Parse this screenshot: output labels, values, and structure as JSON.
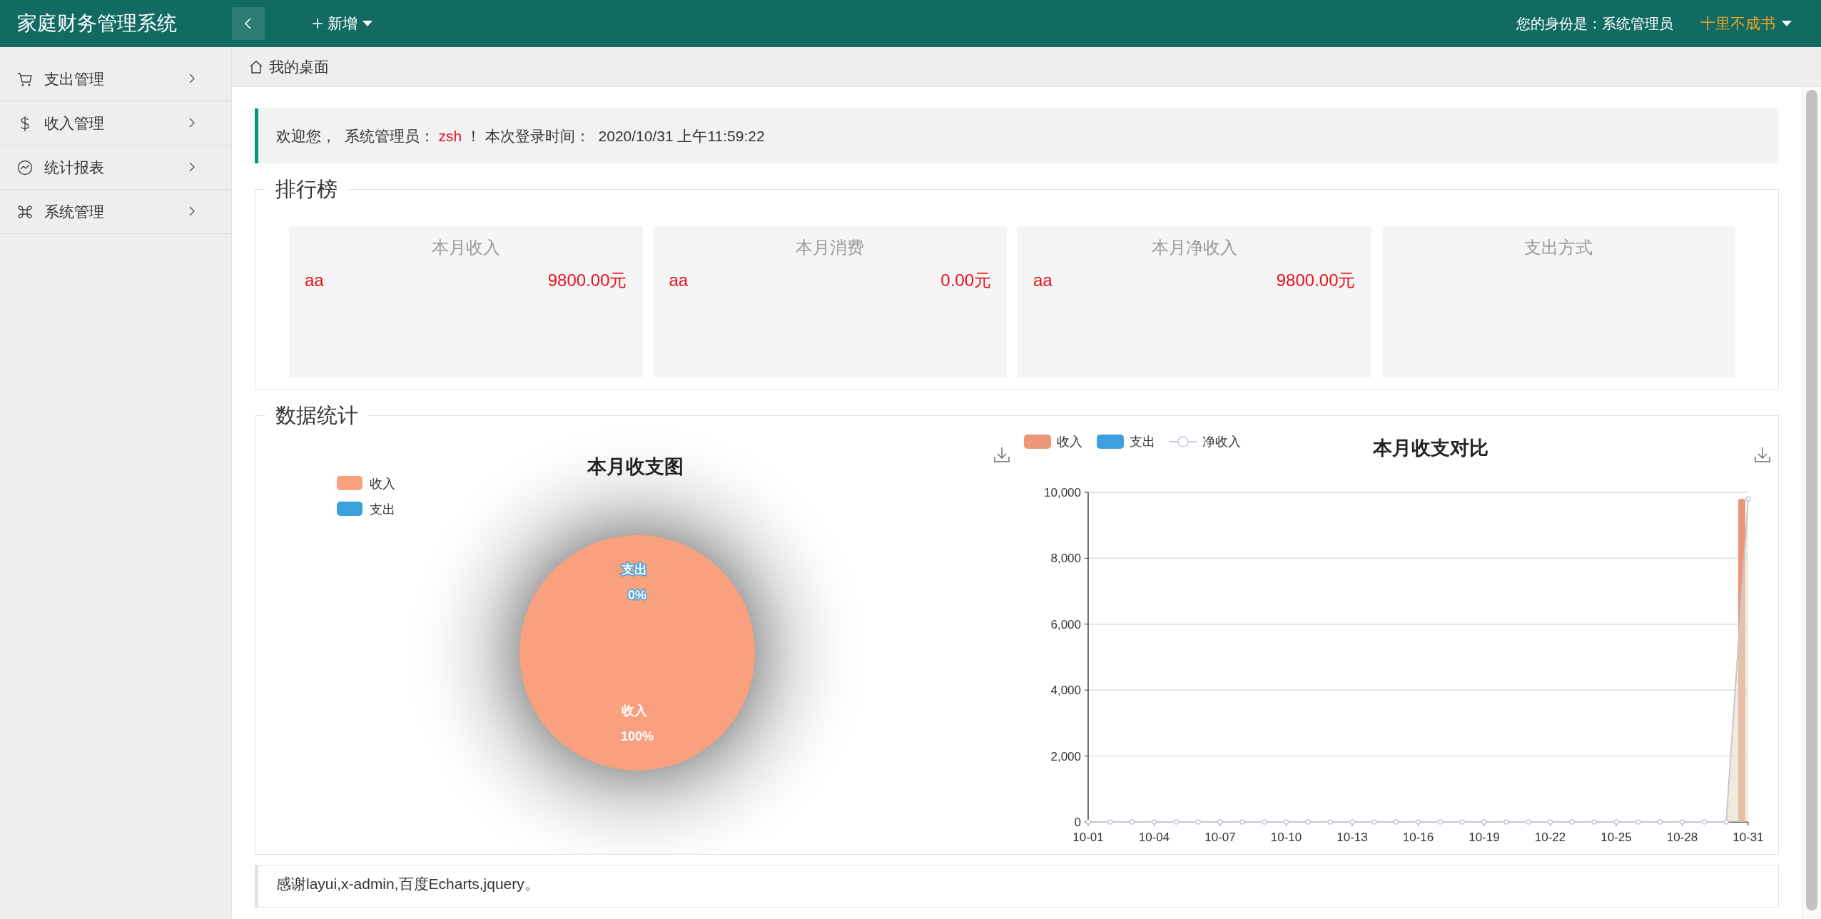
{
  "app_title": "家庭财务管理系统",
  "topbar": {
    "add_menu": "新增",
    "identity": "您的身份是：系统管理员",
    "user": "十里不成书"
  },
  "sidebar": {
    "items": [
      {
        "label": "支出管理",
        "expanded": false
      },
      {
        "label": "收入管理",
        "expanded": false
      },
      {
        "label": "统计报表",
        "expanded": false
      },
      {
        "label": "系统管理",
        "expanded": false
      }
    ]
  },
  "breadcrumb": "我的桌面",
  "welcome": {
    "prefix": "欢迎您，  系统管理员：",
    "user": "zsh",
    "suffix": "！ 本次登录时间：  2020/10/31 上午11:59:22"
  },
  "ranking": {
    "title": "排行榜",
    "cards": [
      {
        "title": "本月收入",
        "rows": [
          {
            "name": "aa",
            "amount": "9800.00元"
          }
        ]
      },
      {
        "title": "本月消费",
        "rows": [
          {
            "name": "aa",
            "amount": "0.00元"
          }
        ]
      },
      {
        "title": "本月净收入",
        "rows": [
          {
            "name": "aa",
            "amount": "9800.00元"
          }
        ]
      },
      {
        "title": "支出方式"
      }
    ]
  },
  "statistics": {
    "title": "数据统计",
    "pie": {
      "chart_data": {
        "type": "pie",
        "title": "本月收支图",
        "categories": [
          "收入",
          "支出"
        ],
        "values": [
          100,
          0
        ],
        "colors": [
          "#f9a07e",
          "#3ba1dd"
        ],
        "legend": true,
        "value_labels": [
          "100%",
          "0%"
        ]
      }
    },
    "trend": {
      "chart_data": {
        "type": "bar",
        "title": "本月收支对比",
        "categories": [
          "10-01",
          null,
          null,
          "10-04",
          null,
          null,
          "10-07",
          null,
          null,
          "10-10",
          null,
          null,
          "10-13",
          null,
          null,
          "10-16",
          null,
          null,
          "10-19",
          null,
          null,
          "10-22",
          null,
          null,
          "10-25",
          null,
          null,
          "10-28",
          null,
          null,
          "10-31"
        ],
        "ylim": [
          0,
          10000
        ],
        "grid": true,
        "legend": true,
        "yticks": [
          0,
          {
            "value": 2000,
            "label": "2,000"
          },
          {
            "value": 4000,
            "label": "4,000"
          },
          {
            "value": 6000,
            "label": "6,000"
          },
          {
            "value": 8000,
            "label": "8,000"
          },
          {
            "value": 10000,
            "label": "10,000"
          }
        ],
        "series": [
          {
            "name": "收入",
            "type": "bar",
            "color": "#ec977a",
            "values": [
              0,
              0,
              0,
              0,
              0,
              0,
              0,
              0,
              0,
              0,
              0,
              0,
              0,
              0,
              0,
              0,
              0,
              0,
              0,
              0,
              0,
              0,
              0,
              0,
              0,
              0,
              0,
              0,
              0,
              0,
              9800
            ]
          },
          {
            "name": "支出",
            "type": "bar",
            "color": "#3ba1dd",
            "values": [
              0,
              0,
              0,
              0,
              0,
              0,
              0,
              0,
              0,
              0,
              0,
              0,
              0,
              0,
              0,
              0,
              0,
              0,
              0,
              0,
              0,
              0,
              0,
              0,
              0,
              0,
              0,
              0,
              0,
              0,
              0
            ]
          },
          {
            "name": "净收入",
            "type": "line",
            "marker": "circle",
            "color": "#c6c6da",
            "values": [
              0,
              0,
              0,
              0,
              0,
              0,
              0,
              0,
              0,
              0,
              0,
              0,
              0,
              0,
              0,
              0,
              0,
              0,
              0,
              0,
              0,
              0,
              0,
              0,
              0,
              0,
              0,
              0,
              0,
              0,
              9800
            ]
          }
        ]
      }
    }
  },
  "footer": "感谢layui,x-admin,百度Echarts,jquery。"
}
